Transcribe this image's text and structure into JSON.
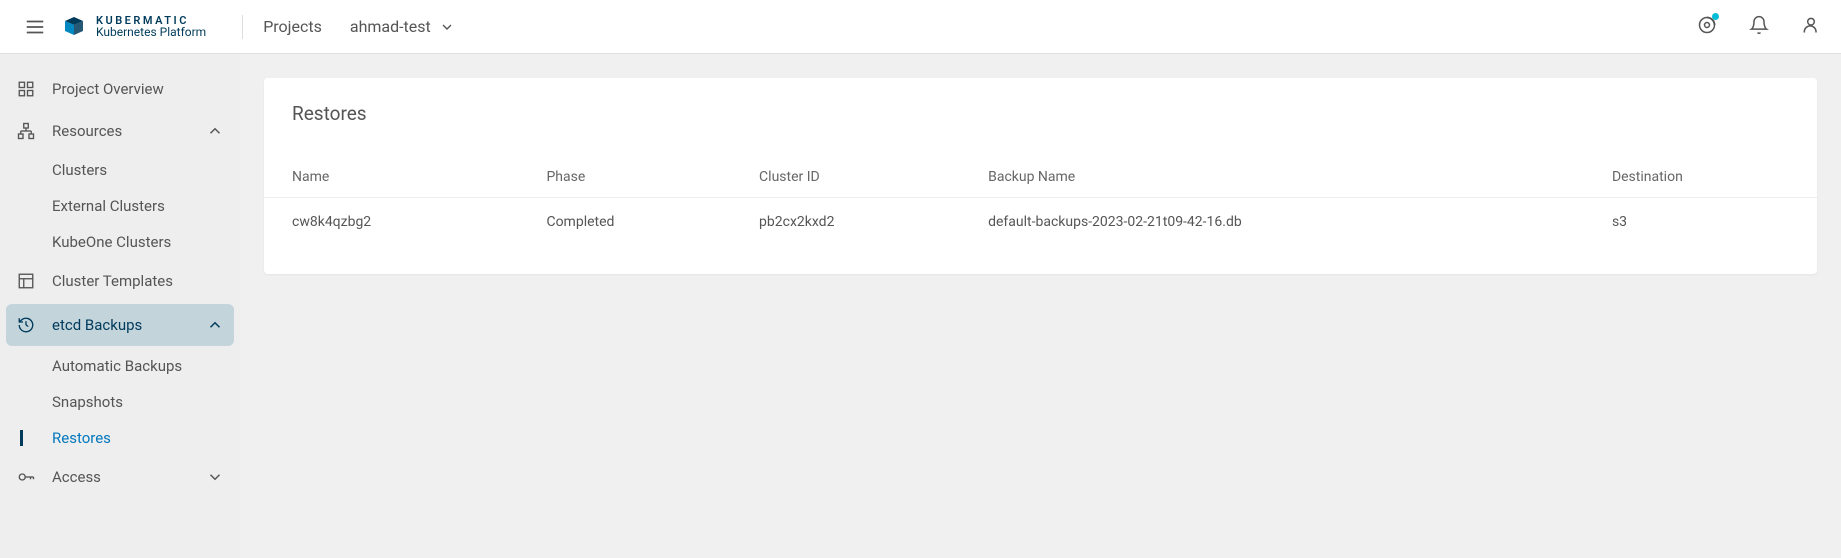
{
  "header": {
    "logo_top": "KUBERMATIC",
    "logo_bottom": "Kubernetes Platform",
    "breadcrumb_root": "Projects",
    "project_name": "ahmad-test"
  },
  "sidebar": {
    "project_overview": "Project Overview",
    "resources": "Resources",
    "clusters": "Clusters",
    "external_clusters": "External Clusters",
    "kubeone_clusters": "KubeOne Clusters",
    "cluster_templates": "Cluster Templates",
    "etcd_backups": "etcd Backups",
    "automatic_backups": "Automatic Backups",
    "snapshots": "Snapshots",
    "restores": "Restores",
    "access": "Access"
  },
  "main": {
    "title": "Restores",
    "columns": {
      "name": "Name",
      "phase": "Phase",
      "cluster_id": "Cluster ID",
      "backup_name": "Backup Name",
      "destination": "Destination"
    },
    "rows": [
      {
        "name": "cw8k4qzbg2",
        "phase": "Completed",
        "cluster_id": "pb2cx2kxd2",
        "backup_name": "default-backups-2023-02-21t09-42-16.db",
        "destination": "s3"
      }
    ]
  }
}
